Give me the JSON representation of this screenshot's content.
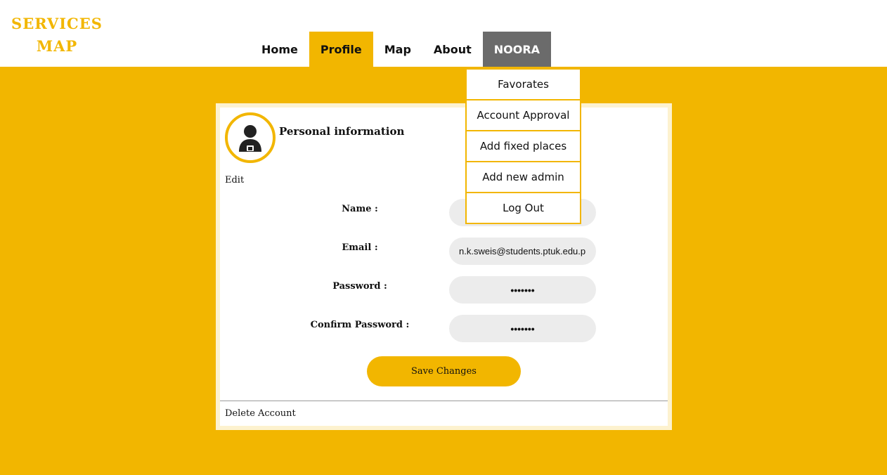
{
  "colors": {
    "accent": "#f2b600",
    "user_tab": "#6b6b6b",
    "input_bg": "#ececec"
  },
  "header": {
    "logo_line1": "SERVICES",
    "logo_line2": "MAP"
  },
  "nav": {
    "items": [
      {
        "label": "Home",
        "active": false
      },
      {
        "label": "Profile",
        "active": true
      },
      {
        "label": "Map",
        "active": false
      },
      {
        "label": "About",
        "active": false
      }
    ],
    "user_label": "NOORA"
  },
  "dropdown": {
    "items": [
      {
        "label": "Favorates"
      },
      {
        "label": "Account Approval"
      },
      {
        "label": "Add fixed places"
      },
      {
        "label": "Add new admin"
      },
      {
        "label": "Log Out"
      }
    ]
  },
  "profile": {
    "avatar_icon": "user-avatar-icon",
    "title": "Personal information",
    "edit_label": "Edit",
    "fields": {
      "name_label": "Name :",
      "name_value": "",
      "email_label": "Email :",
      "email_value": "n.k.sweis@students.ptuk.edu.p",
      "password_label": "Password :",
      "password_value": "•••••••",
      "confirm_label": "Confirm Password :",
      "confirm_value": "•••••••"
    },
    "save_label": "Save Changes",
    "delete_label": "Delete Account"
  }
}
